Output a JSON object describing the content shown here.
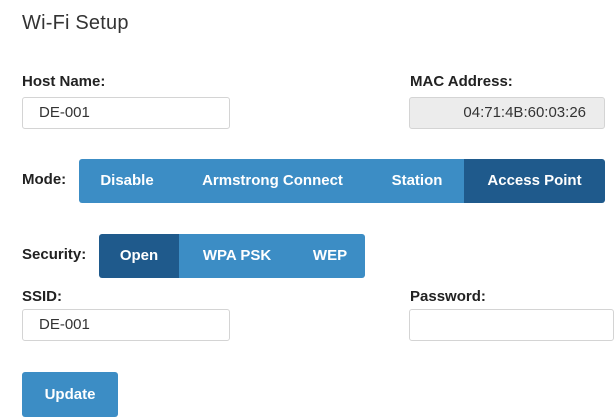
{
  "page": {
    "title": "Wi-Fi Setup"
  },
  "host_name": {
    "label": "Host Name:",
    "value": "DE-001"
  },
  "mac_address": {
    "label": "MAC Address:",
    "value": "04:71:4B:60:03:26"
  },
  "mode": {
    "label": "Mode:",
    "options": [
      "Disable",
      "Armstrong Connect",
      "Station",
      "Access Point"
    ],
    "selected": "Access Point"
  },
  "security": {
    "label": "Security:",
    "options": [
      "Open",
      "WPA PSK",
      "WEP"
    ],
    "selected": "Open"
  },
  "ssid": {
    "label": "SSID:",
    "value": "DE-001"
  },
  "password": {
    "label": "Password:",
    "value": ""
  },
  "actions": {
    "update_label": "Update"
  },
  "colors": {
    "segment": "#3c8dc5",
    "segment_active": "#1f5a8c",
    "readonly_field": "#ececec"
  }
}
